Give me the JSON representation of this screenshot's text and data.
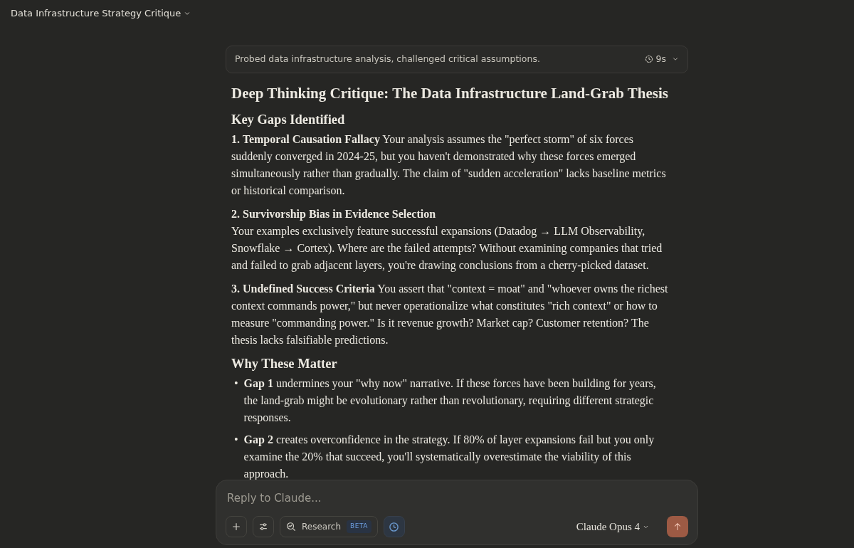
{
  "header": {
    "title": "Data Infrastructure Strategy Critique"
  },
  "thinking": {
    "summary": "Probed data infrastructure analysis, challenged critical assumptions.",
    "duration": "9s",
    "expanded": false
  },
  "response": {
    "title": "Deep Thinking Critique: The Data Infrastructure Land-Grab Thesis",
    "sections": [
      {
        "heading": "Key Gaps Identified",
        "kind": "paragraphs",
        "items": [
          {
            "kind": "inline",
            "title": "1. Temporal Causation Fallacy",
            "body": "Your analysis assumes the \"perfect storm\" of six forces suddenly converged in 2024-25, but you haven't demonstrated why these forces emerged simultaneously rather than gradually. The claim of \"sudden acceleration\" lacks baseline metrics or historical comparison."
          },
          {
            "kind": "block",
            "title": "2. Survivorship Bias in Evidence Selection",
            "body": "Your examples exclusively feature successful expansions (Datadog → LLM Observability, Snowflake → Cortex). Where are the failed attempts? Without examining companies that tried and failed to grab adjacent layers, you're drawing conclusions from a cherry-picked dataset."
          },
          {
            "kind": "inline",
            "title": "3. Undefined Success Criteria",
            "body": "You assert that \"context = moat\" and \"whoever owns the richest context commands power,\" but never operationalize what constitutes \"rich context\" or how to measure \"commanding power.\" Is it revenue growth? Market cap? Customer retention? The thesis lacks falsifiable predictions."
          }
        ]
      },
      {
        "heading": "Why These Matter",
        "kind": "bullets",
        "items": [
          {
            "marker": "•",
            "text": "**Gap 1** undermines your \"why now\" narrative. If these forces have been building for years, the land-grab might be evolutionary rather than revolutionary, requiring different strategic responses."
          },
          {
            "marker": "•",
            "text": "**Gap 2** creates overconfidence in the strategy. If 80% of layer expansions fail but you only examine the 20% that succeed, you'll systematically overestimate the viability of this approach."
          }
        ]
      }
    ]
  },
  "composer": {
    "placeholder": "Reply to Claude...",
    "tools": [
      {
        "kind": "plus"
      },
      {
        "kind": "sliders"
      }
    ],
    "research": {
      "label": "Research",
      "badge": "BETA",
      "selected": false
    },
    "history_toggle": {
      "selected": true
    },
    "model": "Claude Opus 4"
  }
}
